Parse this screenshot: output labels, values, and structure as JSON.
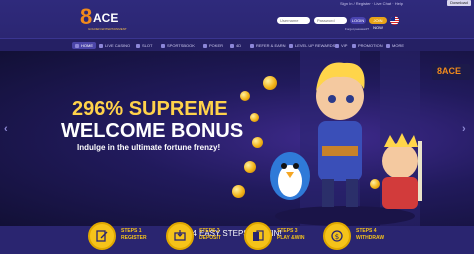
{
  "header": {
    "logo_number": "8",
    "logo_text": "ACE",
    "logo_tagline": "GOLDEN ENTERTAINMENT",
    "top_info": "Sign In / Register · Live Chat · Help",
    "app_badge": "Download",
    "username_placeholder": "Username",
    "password_placeholder": "Password",
    "login_label": "LOGIN",
    "join_label": "JOIN NOW",
    "forgot_label": "Forgot password?"
  },
  "nav": {
    "items": [
      {
        "label": "HOME",
        "active": true
      },
      {
        "label": "LIVE CASINO",
        "active": false
      },
      {
        "label": "SLOT",
        "active": false
      },
      {
        "label": "SPORTSBOOK",
        "active": false
      },
      {
        "label": "POKER",
        "active": false
      },
      {
        "label": "4D",
        "active": false
      },
      {
        "label": "REFER & EARN",
        "active": false
      },
      {
        "label": "LEVEL UP REWARDS",
        "active": false
      },
      {
        "label": "VIP",
        "active": false
      },
      {
        "label": "PROMOTION",
        "active": false
      },
      {
        "label": "MORE",
        "active": false
      }
    ]
  },
  "banner": {
    "title_line1": "296% SUPREME",
    "title_line2": "WELCOME BONUS",
    "subtitle": "Indulge in the ultimate fortune frenzy!",
    "prev_arrow": "‹",
    "next_arrow": "›",
    "badge_logo": "8ACE"
  },
  "steps": {
    "title": "4 EASY STEPS TO WIN!",
    "items": [
      {
        "num": "STEPS 1",
        "label": "REGISTER",
        "icon": "register-icon"
      },
      {
        "num": "STEPS 2",
        "label": "DEPOSIT",
        "icon": "deposit-icon"
      },
      {
        "num": "STEPS 3",
        "label": "PLAY &WIN",
        "icon": "cards-icon"
      },
      {
        "num": "STEPS 4",
        "label": "WITHDRAW",
        "icon": "withdraw-icon"
      }
    ]
  },
  "colors": {
    "accent": "#f5c31a",
    "brand_orange": "#f08a1c",
    "background": "#2a2570",
    "login": "#4a44b0",
    "join": "#e8a317"
  }
}
